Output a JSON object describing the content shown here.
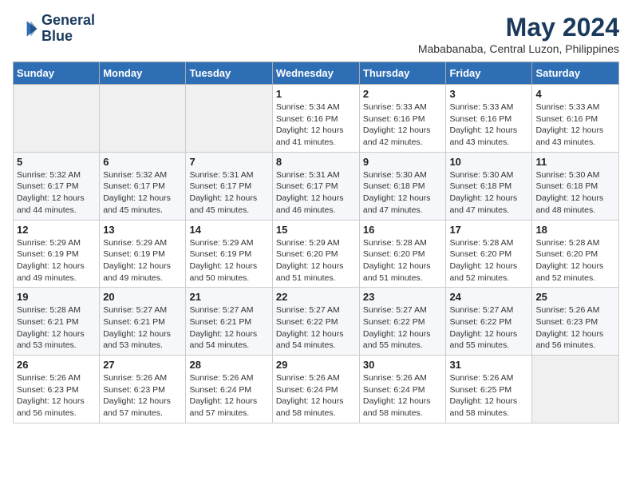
{
  "logo": {
    "line1": "General",
    "line2": "Blue"
  },
  "title": "May 2024",
  "location": "Mababanaba, Central Luzon, Philippines",
  "weekdays": [
    "Sunday",
    "Monday",
    "Tuesday",
    "Wednesday",
    "Thursday",
    "Friday",
    "Saturday"
  ],
  "weeks": [
    [
      {
        "day": "",
        "info": ""
      },
      {
        "day": "",
        "info": ""
      },
      {
        "day": "",
        "info": ""
      },
      {
        "day": "1",
        "info": "Sunrise: 5:34 AM\nSunset: 6:16 PM\nDaylight: 12 hours\nand 41 minutes."
      },
      {
        "day": "2",
        "info": "Sunrise: 5:33 AM\nSunset: 6:16 PM\nDaylight: 12 hours\nand 42 minutes."
      },
      {
        "day": "3",
        "info": "Sunrise: 5:33 AM\nSunset: 6:16 PM\nDaylight: 12 hours\nand 43 minutes."
      },
      {
        "day": "4",
        "info": "Sunrise: 5:33 AM\nSunset: 6:16 PM\nDaylight: 12 hours\nand 43 minutes."
      }
    ],
    [
      {
        "day": "5",
        "info": "Sunrise: 5:32 AM\nSunset: 6:17 PM\nDaylight: 12 hours\nand 44 minutes."
      },
      {
        "day": "6",
        "info": "Sunrise: 5:32 AM\nSunset: 6:17 PM\nDaylight: 12 hours\nand 45 minutes."
      },
      {
        "day": "7",
        "info": "Sunrise: 5:31 AM\nSunset: 6:17 PM\nDaylight: 12 hours\nand 45 minutes."
      },
      {
        "day": "8",
        "info": "Sunrise: 5:31 AM\nSunset: 6:17 PM\nDaylight: 12 hours\nand 46 minutes."
      },
      {
        "day": "9",
        "info": "Sunrise: 5:30 AM\nSunset: 6:18 PM\nDaylight: 12 hours\nand 47 minutes."
      },
      {
        "day": "10",
        "info": "Sunrise: 5:30 AM\nSunset: 6:18 PM\nDaylight: 12 hours\nand 47 minutes."
      },
      {
        "day": "11",
        "info": "Sunrise: 5:30 AM\nSunset: 6:18 PM\nDaylight: 12 hours\nand 48 minutes."
      }
    ],
    [
      {
        "day": "12",
        "info": "Sunrise: 5:29 AM\nSunset: 6:19 PM\nDaylight: 12 hours\nand 49 minutes."
      },
      {
        "day": "13",
        "info": "Sunrise: 5:29 AM\nSunset: 6:19 PM\nDaylight: 12 hours\nand 49 minutes."
      },
      {
        "day": "14",
        "info": "Sunrise: 5:29 AM\nSunset: 6:19 PM\nDaylight: 12 hours\nand 50 minutes."
      },
      {
        "day": "15",
        "info": "Sunrise: 5:29 AM\nSunset: 6:20 PM\nDaylight: 12 hours\nand 51 minutes."
      },
      {
        "day": "16",
        "info": "Sunrise: 5:28 AM\nSunset: 6:20 PM\nDaylight: 12 hours\nand 51 minutes."
      },
      {
        "day": "17",
        "info": "Sunrise: 5:28 AM\nSunset: 6:20 PM\nDaylight: 12 hours\nand 52 minutes."
      },
      {
        "day": "18",
        "info": "Sunrise: 5:28 AM\nSunset: 6:20 PM\nDaylight: 12 hours\nand 52 minutes."
      }
    ],
    [
      {
        "day": "19",
        "info": "Sunrise: 5:28 AM\nSunset: 6:21 PM\nDaylight: 12 hours\nand 53 minutes."
      },
      {
        "day": "20",
        "info": "Sunrise: 5:27 AM\nSunset: 6:21 PM\nDaylight: 12 hours\nand 53 minutes."
      },
      {
        "day": "21",
        "info": "Sunrise: 5:27 AM\nSunset: 6:21 PM\nDaylight: 12 hours\nand 54 minutes."
      },
      {
        "day": "22",
        "info": "Sunrise: 5:27 AM\nSunset: 6:22 PM\nDaylight: 12 hours\nand 54 minutes."
      },
      {
        "day": "23",
        "info": "Sunrise: 5:27 AM\nSunset: 6:22 PM\nDaylight: 12 hours\nand 55 minutes."
      },
      {
        "day": "24",
        "info": "Sunrise: 5:27 AM\nSunset: 6:22 PM\nDaylight: 12 hours\nand 55 minutes."
      },
      {
        "day": "25",
        "info": "Sunrise: 5:26 AM\nSunset: 6:23 PM\nDaylight: 12 hours\nand 56 minutes."
      }
    ],
    [
      {
        "day": "26",
        "info": "Sunrise: 5:26 AM\nSunset: 6:23 PM\nDaylight: 12 hours\nand 56 minutes."
      },
      {
        "day": "27",
        "info": "Sunrise: 5:26 AM\nSunset: 6:23 PM\nDaylight: 12 hours\nand 57 minutes."
      },
      {
        "day": "28",
        "info": "Sunrise: 5:26 AM\nSunset: 6:24 PM\nDaylight: 12 hours\nand 57 minutes."
      },
      {
        "day": "29",
        "info": "Sunrise: 5:26 AM\nSunset: 6:24 PM\nDaylight: 12 hours\nand 58 minutes."
      },
      {
        "day": "30",
        "info": "Sunrise: 5:26 AM\nSunset: 6:24 PM\nDaylight: 12 hours\nand 58 minutes."
      },
      {
        "day": "31",
        "info": "Sunrise: 5:26 AM\nSunset: 6:25 PM\nDaylight: 12 hours\nand 58 minutes."
      },
      {
        "day": "",
        "info": ""
      }
    ]
  ]
}
